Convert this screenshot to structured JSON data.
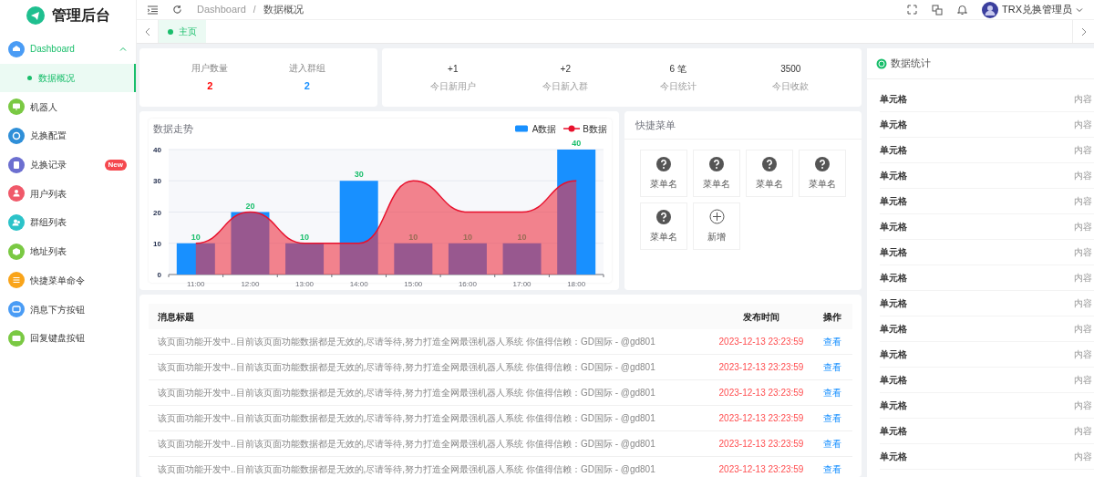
{
  "brand": {
    "title": "管理后台"
  },
  "sidebar": {
    "items": [
      {
        "label": "Dashboard",
        "color": "#4a9cf5",
        "expanded": true,
        "selected": false,
        "children": [
          {
            "label": "数据概况",
            "selected": true
          }
        ]
      },
      {
        "label": "机器人",
        "color": "#7ac943",
        "selected": false
      },
      {
        "label": "兑换配置",
        "color": "#2f8fd8",
        "selected": false
      },
      {
        "label": "兑换记录",
        "color": "#6c6fd0",
        "selected": false,
        "badge": "New"
      },
      {
        "label": "用户列表",
        "color": "#f0596a",
        "selected": false
      },
      {
        "label": "群组列表",
        "color": "#2cc3c9",
        "selected": false
      },
      {
        "label": "地址列表",
        "color": "#7ac943",
        "selected": false
      },
      {
        "label": "快捷菜单命令",
        "color": "#f9a41a",
        "selected": false
      },
      {
        "label": "消息下方按钮",
        "color": "#4a9cf5",
        "selected": false
      },
      {
        "label": "回复键盘按钮",
        "color": "#7ac943",
        "selected": false
      }
    ]
  },
  "breadcrumb": [
    "Dashboard",
    "数据概况"
  ],
  "breadcrumb_separator": "/",
  "user": {
    "name": "TRX兑换管理员"
  },
  "tabs": [
    {
      "label": "主页",
      "selected": true
    }
  ],
  "summary": [
    {
      "label": "用户数量",
      "value": "2",
      "color": "#ff0000"
    },
    {
      "label": "进入群组",
      "value": "2",
      "color": "#1890ff"
    }
  ],
  "today": [
    {
      "value": "+1",
      "label": "今日新用户"
    },
    {
      "value": "+2",
      "label": "今日新入群"
    },
    {
      "value": "6 笔",
      "label": "今日统计"
    },
    {
      "value": "3500",
      "label": "今日收款"
    }
  ],
  "trend": {
    "chart_data": {
      "type": "bar",
      "title": "数据走势",
      "categories": [
        "11:00",
        "12:00",
        "13:00",
        "14:00",
        "15:00",
        "16:00",
        "17:00",
        "18:00"
      ],
      "series": [
        {
          "name": "A数据",
          "color": "#1890ff",
          "type": "bar",
          "values": [
            10,
            20,
            10,
            30,
            10,
            10,
            10,
            40
          ],
          "value_labels": [
            "10",
            "20",
            "10",
            "30",
            "10",
            "10",
            "10",
            "40"
          ]
        },
        {
          "name": "B数据",
          "color": "#e8112d",
          "type": "area",
          "values": [
            10,
            20,
            10,
            10,
            30,
            20,
            20,
            30
          ]
        }
      ],
      "ylim": [
        0,
        40
      ],
      "yticks": [
        0,
        10,
        20,
        30,
        40
      ],
      "grid": true
    }
  },
  "quick_menu": {
    "title": "快捷菜单",
    "items": [
      {
        "kind": "item",
        "label": "菜单名"
      },
      {
        "kind": "item",
        "label": "菜单名"
      },
      {
        "kind": "item",
        "label": "菜单名"
      },
      {
        "kind": "item",
        "label": "菜单名"
      },
      {
        "kind": "item",
        "label": "菜单名"
      },
      {
        "kind": "add",
        "label": "新增"
      }
    ]
  },
  "messages": {
    "columns": [
      "消息标题",
      "发布时间",
      "操作"
    ],
    "rows": [
      {
        "title": "该页面功能开发中..目前该页面功能数据都是无效的,尽请等待,努力打造全网最强机器人系统 你值得信赖：GD国际 - @gd801",
        "time": "2023-12-13 23:23:59",
        "action": "查看"
      },
      {
        "title": "该页面功能开发中..目前该页面功能数据都是无效的,尽请等待,努力打造全网最强机器人系统 你值得信赖：GD国际 - @gd801",
        "time": "2023-12-13 23:23:59",
        "action": "查看"
      },
      {
        "title": "该页面功能开发中..目前该页面功能数据都是无效的,尽请等待,努力打造全网最强机器人系统 你值得信赖：GD国际 - @gd801",
        "time": "2023-12-13 23:23:59",
        "action": "查看"
      },
      {
        "title": "该页面功能开发中..目前该页面功能数据都是无效的,尽请等待,努力打造全网最强机器人系统 你值得信赖：GD国际 - @gd801",
        "time": "2023-12-13 23:23:59",
        "action": "查看"
      },
      {
        "title": "该页面功能开发中..目前该页面功能数据都是无效的,尽请等待,努力打造全网最强机器人系统 你值得信赖：GD国际 - @gd801",
        "time": "2023-12-13 23:23:59",
        "action": "查看"
      },
      {
        "title": "该页面功能开发中..目前该页面功能数据都是无效的,尽请等待,努力打造全网最强机器人系统 你值得信赖：GD国际 - @gd801",
        "time": "2023-12-13 23:23:59",
        "action": "查看"
      }
    ]
  },
  "stats": {
    "title": "数据统计",
    "rows": [
      {
        "label": "单元格",
        "value": "内容"
      },
      {
        "label": "单元格",
        "value": "内容"
      },
      {
        "label": "单元格",
        "value": "内容"
      },
      {
        "label": "单元格",
        "value": "内容"
      },
      {
        "label": "单元格",
        "value": "内容"
      },
      {
        "label": "单元格",
        "value": "内容"
      },
      {
        "label": "单元格",
        "value": "内容"
      },
      {
        "label": "单元格",
        "value": "内容"
      },
      {
        "label": "单元格",
        "value": "内容"
      },
      {
        "label": "单元格",
        "value": "内容"
      },
      {
        "label": "单元格",
        "value": "内容"
      },
      {
        "label": "单元格",
        "value": "内容"
      },
      {
        "label": "单元格",
        "value": "内容"
      },
      {
        "label": "单元格",
        "value": "内容"
      },
      {
        "label": "单元格",
        "value": "内容"
      }
    ]
  }
}
